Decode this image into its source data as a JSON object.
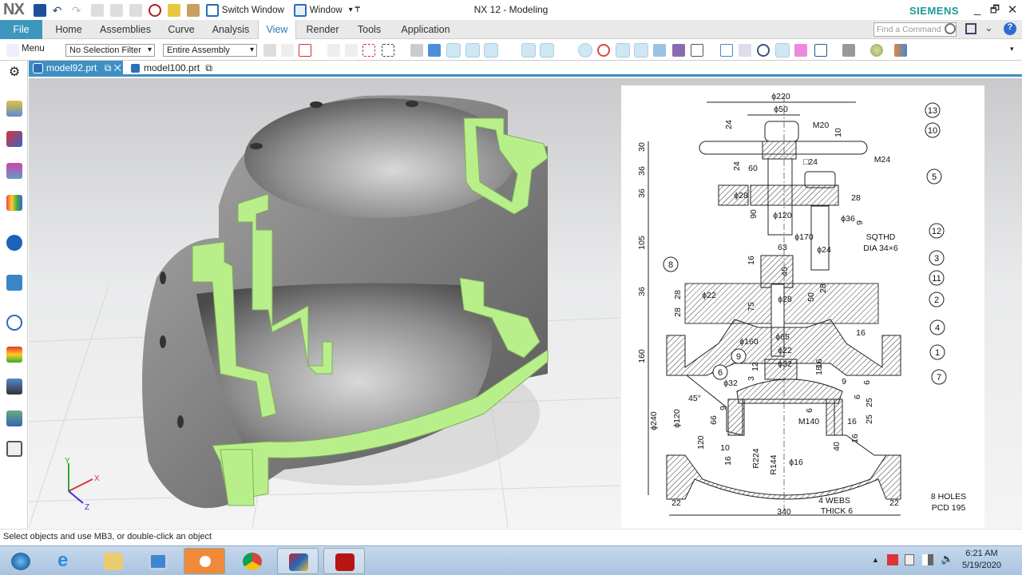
{
  "titlebar": {
    "logo": "NX",
    "switch_window": "Switch Window",
    "window": "Window",
    "title": "NX 12 - Modeling",
    "brand": "SIEMENS",
    "minimize": "_",
    "restore": "🗗",
    "close": "✕"
  },
  "ribbon": {
    "tabs": [
      "File",
      "Home",
      "Assemblies",
      "Curve",
      "Analysis",
      "View",
      "Render",
      "Tools",
      "Application"
    ],
    "active": "View",
    "find_placeholder": "Find a Command"
  },
  "toolbar": {
    "menu": "Menu",
    "selection_filter": "No Selection Filter",
    "scope": "Entire Assembly"
  },
  "doc_tabs": [
    {
      "label": "model92.prt",
      "active": true
    },
    {
      "label": "model100.prt",
      "active": false
    }
  ],
  "triad": {
    "x": "X",
    "y": "Y",
    "z": "Z"
  },
  "drawing": {
    "dims": [
      "ϕ220",
      "ϕ50",
      "M20",
      "24",
      "10",
      "30",
      "24",
      "□24",
      "60",
      "M24",
      "36",
      "36",
      "ϕ28",
      "28",
      "90",
      "ϕ120",
      "ϕ36",
      "9",
      "ϕ170",
      "SQTHD",
      "DIA 34×6",
      "105",
      "63",
      "ϕ24",
      "16",
      "45",
      "36",
      "28",
      "ϕ22",
      "ϕ28",
      "50",
      "28",
      "75",
      "28",
      "16",
      "ϕ65",
      "ϕ160",
      "160",
      "ϕ22",
      "ϕ32",
      "12",
      "16",
      "18",
      "3",
      "ϕ32",
      "9",
      "6",
      "45°",
      "6",
      "25",
      "9",
      "ϕ240",
      "ϕ120",
      "66",
      "6",
      "M140",
      "16",
      "25",
      "120",
      "10",
      "40",
      "16",
      "16",
      "R224",
      "R144",
      "ϕ16",
      "4 WEBS",
      "THICK 6",
      "8 HOLES",
      "PCD 195",
      "22",
      "22",
      "340"
    ],
    "balloons": [
      "13",
      "10",
      "5",
      "12",
      "3",
      "8",
      "11",
      "2",
      "4",
      "1",
      "9",
      "7",
      "6"
    ]
  },
  "status": {
    "message": "Select objects and use MB3, or double-click an object"
  },
  "taskbar": {
    "apps": [
      "start",
      "internet-explorer",
      "file-explorer",
      "media-player",
      "nx",
      "chrome",
      "nx-viewer",
      "acrobat"
    ],
    "time": "6:21 AM",
    "date": "5/19/2020"
  },
  "colors": {
    "file_tab": "#3d97bd",
    "active_doc_tab": "#3e8fc3",
    "section_face": "#b8ef8a"
  }
}
